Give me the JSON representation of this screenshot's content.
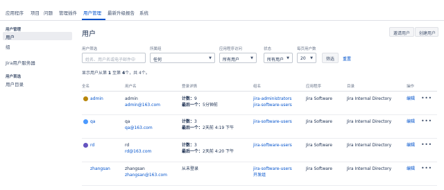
{
  "nav": {
    "tabs": [
      {
        "label": "应用程序"
      },
      {
        "label": "项目"
      },
      {
        "label": "问题"
      },
      {
        "label": "管理插件"
      },
      {
        "label": "用户管理"
      },
      {
        "label": "最新升级报告"
      },
      {
        "label": "系统"
      }
    ],
    "active_tab": "用户管理"
  },
  "sidebar": {
    "section1": "用户管理",
    "items1": [
      "用户",
      "组",
      "Jira用户服务器"
    ],
    "section2": "用户首选",
    "items2": [
      "用户目录"
    ]
  },
  "main": {
    "title": "用户",
    "invite_button": "邀请用户",
    "create_button": "创建用户",
    "filters": {
      "user_filter_label": "用户筛选",
      "user_filter_placeholder": "姓名、用户名或电子邮件中",
      "group_label": "所属组",
      "group_value": "任何",
      "app_label": "应用程序访问",
      "app_value": "所有用户",
      "status_label": "状态",
      "status_value": "所有用户",
      "per_page_label": "每页用户数",
      "per_page_value": "20",
      "filter_button": "筛选",
      "reset_link": "重置"
    },
    "summary": {
      "prefix": "显示用户从第 ",
      "start": "1",
      "mid": " 至第 ",
      "end": "4",
      "suffix": "个，共 4个。"
    },
    "columns": [
      "全名",
      "用户名",
      "登录详情",
      "组名",
      "应用程序",
      "目录",
      "操作"
    ],
    "rows": [
      {
        "fullname": "admin",
        "username": "admin",
        "email": "admin@163.com",
        "login_count_label": "计数：",
        "login_count": "9",
        "last_login_label": "最后一个：",
        "last_login": "5分钟前",
        "groups": [
          "jira-administrators",
          "jira-software-users"
        ],
        "application": "Jira Software",
        "directory": "Jira Internal Directory",
        "edit": "编辑",
        "more": "•••",
        "avatar_color": "#b8860b"
      },
      {
        "fullname": "qa",
        "username": "qa",
        "email": "qa@163.com",
        "login_count_label": "计数：",
        "login_count": "3",
        "last_login_label": "最后一个：",
        "last_login": "2天前 4:19 下午",
        "groups": [
          "jira-software-users"
        ],
        "application": "Jira Software",
        "directory": "Jira Internal Directory",
        "edit": "编辑",
        "more": "•••",
        "avatar_color": "#4c9aff"
      },
      {
        "fullname": "rd",
        "username": "rd",
        "email": "rd@163.com",
        "login_count_label": "计数：",
        "login_count": "3",
        "last_login_label": "最后一个：",
        "last_login": "2天前 4:20 下午",
        "groups": [
          "jira-software-users"
        ],
        "application": "Jira Software",
        "directory": "Jira Internal Directory",
        "edit": "编辑",
        "more": "•••",
        "avatar_color": "#6554c0"
      },
      {
        "fullname": "zhangsan",
        "username": "zhangsan",
        "email": "zhangsan@163.com",
        "never_login": "从未登录",
        "groups": [
          "jira-software-users",
          "开发组"
        ],
        "application": "Jira Software",
        "directory": "Jira Internal Directory",
        "edit": "编辑",
        "more": "•••"
      }
    ]
  }
}
